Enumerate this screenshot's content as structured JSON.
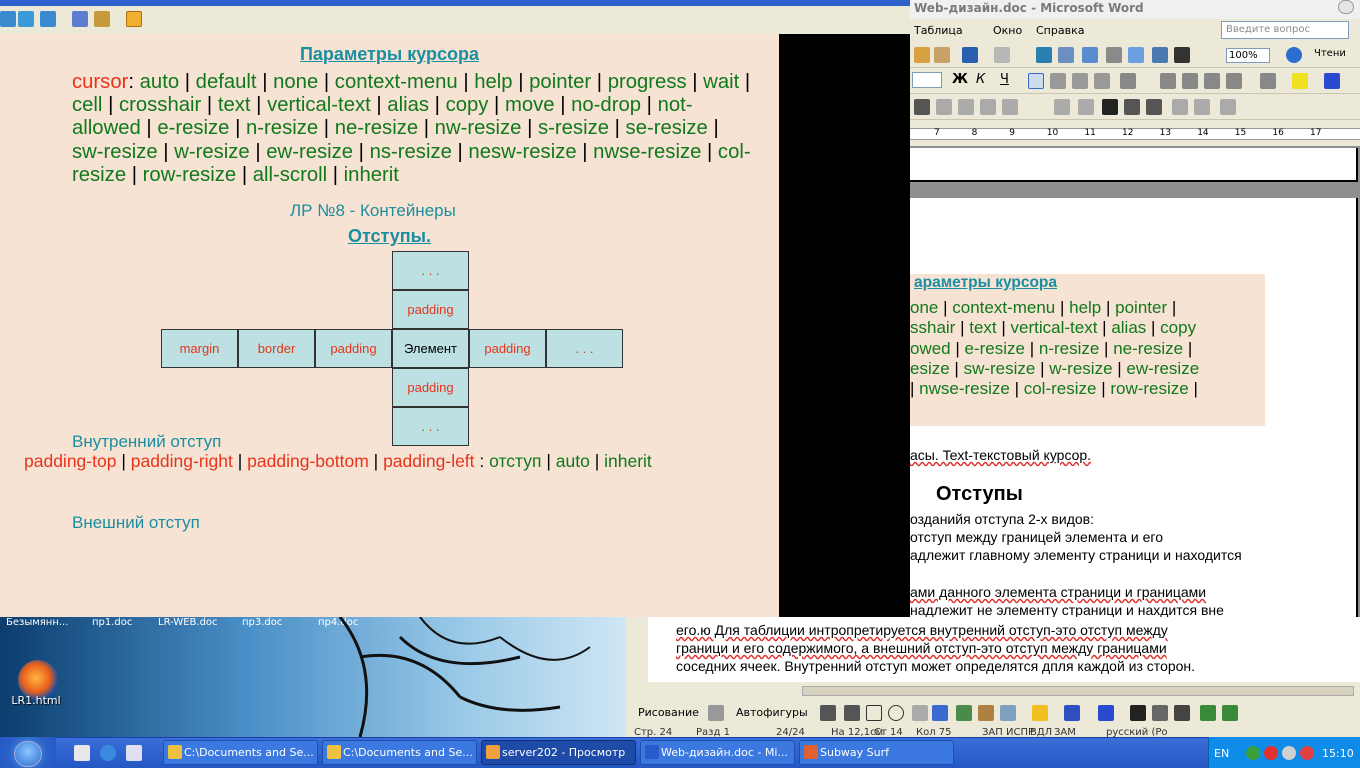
{
  "browser": {
    "heading": "Параметры курсора",
    "cursor_keyword": "cursor",
    "cursor_values": [
      "auto",
      "default",
      "none",
      "context-menu",
      "help",
      "pointer",
      "progress",
      "wait",
      "cell",
      "crosshair",
      "text",
      "vertical-text",
      "alias",
      "copy",
      "move",
      "no-drop",
      "not-allowed",
      "e-resize",
      "n-resize",
      "ne-resize",
      "nw-resize",
      "s-resize",
      "se-resize",
      "sw-resize",
      "w-resize",
      "ew-resize",
      "ns-resize",
      "nesw-resize",
      "nwse-resize",
      "col-resize",
      "row-resize",
      "all-scroll",
      "inherit"
    ],
    "lr_title": "ЛР №8 - Контейнеры",
    "otstupy": "Отступы.",
    "box": {
      "top2": ". . .",
      "top1": "padding",
      "row": [
        "margin",
        "border",
        "padding",
        "Элемент",
        "padding",
        ". . ."
      ],
      "bot1": "padding",
      "bot2": ". . ."
    },
    "vnutr": "Внутренний отступ",
    "pad_props": [
      "padding-top",
      "padding-right",
      "padding-bottom",
      "padding-left"
    ],
    "pad_values": [
      "отступ",
      "auto",
      "inherit"
    ],
    "vnesh": "Внешний отступ"
  },
  "desktop": {
    "tabs": [
      "Безымянн...",
      "пр1.doc",
      "LR-WEB.doc",
      "пр3.doc",
      "пр4.doc"
    ],
    "icon_label": "LR1.html"
  },
  "word": {
    "title": "Web-дизайн.doc - Microsoft Word",
    "menu": [
      "Таблица",
      "Окно",
      "Справка"
    ],
    "ask_placeholder": "Введите вопрос",
    "zoom": "100%",
    "read_button": "Чтени",
    "ruler": [
      "7",
      "8",
      "9",
      "10",
      "11",
      "12",
      "13",
      "14",
      "15",
      "16",
      "17"
    ],
    "box_title": "араметры курсора",
    "box_lines": [
      [
        "one",
        "context-menu",
        "help",
        "pointer",
        ""
      ],
      [
        "sshair",
        "text",
        "vertical-text",
        "alias",
        "copy"
      ],
      [
        "owed",
        "e-resize",
        "n-resize",
        "ne-resize",
        ""
      ],
      [
        "esize",
        "sw-resize",
        "w-resize",
        "ew-resize"
      ],
      [
        "",
        "nwse-resize",
        "col-resize",
        "row-resize",
        ""
      ]
    ],
    "text_line1": "асы. Text-текстовый курсор.",
    "heading": "Отступы",
    "body": [
      "озданийя отступа 2-х видов:",
      "отступ между границей элемента и его",
      "адлежит главному элементу страници и находится",
      "ами данного элемента страници и границами",
      "надлежит не элементу страници и нахдится вне",
      "его.ю Для таблиции интропретируется внутренний отступ-это отступ между",
      "граници и его содержимого, а внешний отступ-это отступ между границами",
      "соседних ячеек. Внутренний отступ может определятся дпля каждой из сторон."
    ],
    "draw_label": "Рисование",
    "autoshapes_label": "Автофигуры",
    "status": [
      "Стр. 24",
      "Разд 1",
      "24/24",
      "На 12,1см",
      "Ст 14",
      "Кол 75",
      "ЗАП",
      "ИСПР",
      "ВДЛ",
      "ЗАМ",
      "русский (Ро"
    ]
  },
  "taskbar": {
    "tasks": [
      "C:\\Documents and Se...",
      "C:\\Documents and Se...",
      "server202 - Просмотр",
      "Web-дизайн.doc - Mi...",
      "Subway Surf"
    ],
    "lang": "EN",
    "clock": "15:10"
  }
}
